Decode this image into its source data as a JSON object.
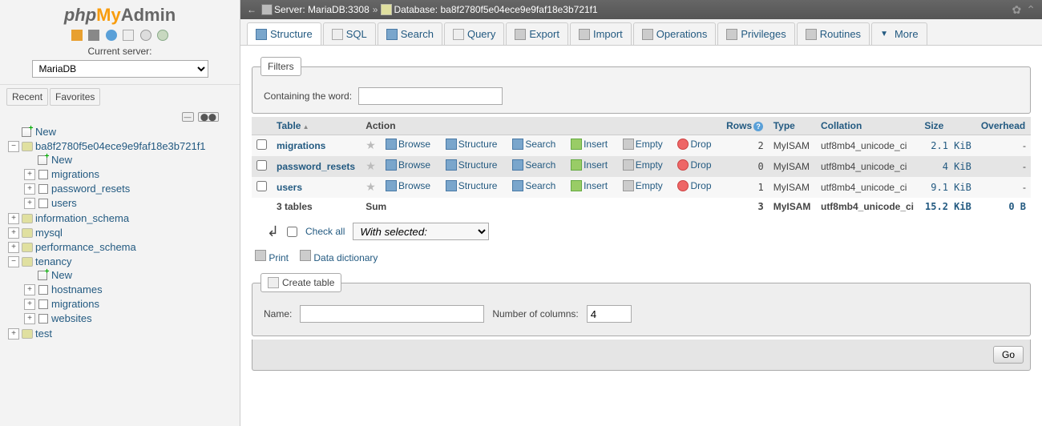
{
  "logo": {
    "php": "php",
    "my": "My",
    "admin": "Admin"
  },
  "sidebar": {
    "current_server_label": "Current server:",
    "selected_server": "MariaDB",
    "recent": "Recent",
    "favorites": "Favorites",
    "nodes": {
      "new": "New",
      "db_current": "ba8f2780f5e04ece9e9faf18e3b721f1",
      "db_current_children": {
        "new": "New",
        "migrations": "migrations",
        "password_resets": "password_resets",
        "users": "users"
      },
      "information_schema": "information_schema",
      "mysql": "mysql",
      "performance_schema": "performance_schema",
      "tenancy": "tenancy",
      "tenancy_children": {
        "new": "New",
        "hostnames": "hostnames",
        "migrations": "migrations",
        "websites": "websites"
      },
      "test": "test"
    }
  },
  "breadcrumb": {
    "server_label": "Server:",
    "server_val": "MariaDB:3308",
    "db_label": "Database:",
    "db_val": "ba8f2780f5e04ece9e9faf18e3b721f1"
  },
  "tabs": {
    "structure": "Structure",
    "sql": "SQL",
    "search": "Search",
    "query": "Query",
    "export": "Export",
    "import": "Import",
    "operations": "Operations",
    "privileges": "Privileges",
    "routines": "Routines",
    "more": "More"
  },
  "filters": {
    "legend": "Filters",
    "containing": "Containing the word:",
    "value": ""
  },
  "table_headers": {
    "table": "Table",
    "action": "Action",
    "rows": "Rows",
    "type": "Type",
    "collation": "Collation",
    "size": "Size",
    "overhead": "Overhead"
  },
  "actions": {
    "browse": "Browse",
    "structure": "Structure",
    "search": "Search",
    "insert": "Insert",
    "empty": "Empty",
    "drop": "Drop"
  },
  "tables": [
    {
      "name": "migrations",
      "rows": "2",
      "type": "MyISAM",
      "collation": "utf8mb4_unicode_ci",
      "size": "2.1 KiB",
      "overhead": "-"
    },
    {
      "name": "password_resets",
      "rows": "0",
      "type": "MyISAM",
      "collation": "utf8mb4_unicode_ci",
      "size": "4 KiB",
      "overhead": "-"
    },
    {
      "name": "users",
      "rows": "1",
      "type": "MyISAM",
      "collation": "utf8mb4_unicode_ci",
      "size": "9.1 KiB",
      "overhead": "-"
    }
  ],
  "sum_row": {
    "label": "3 tables",
    "sum": "Sum",
    "rows": "3",
    "type": "MyISAM",
    "collation": "utf8mb4_unicode_ci",
    "size": "15.2 KiB",
    "overhead": "0 B"
  },
  "checkall": {
    "label": "Check all",
    "with_selected": "With selected:"
  },
  "print_row": {
    "print": "Print",
    "data_dictionary": "Data dictionary"
  },
  "create_table": {
    "legend": "Create table",
    "name_label": "Name:",
    "name_value": "",
    "cols_label": "Number of columns:",
    "cols_value": "4",
    "go": "Go"
  }
}
